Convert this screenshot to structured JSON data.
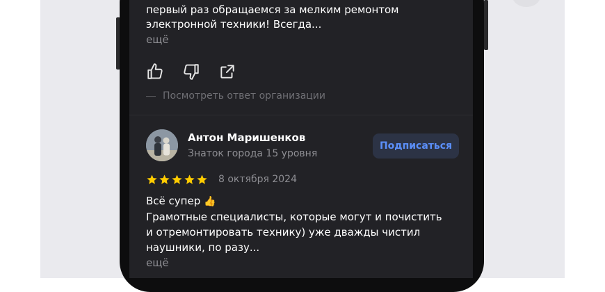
{
  "previous_review": {
    "text_line1": "первый раз обращаемся за мелким ремонтом",
    "text_line2": "электронной техники! Всегда...",
    "more_label": "ещё",
    "org_reply_label": "Посмотреть ответ организации",
    "actions": [
      "thumbs-up-icon",
      "thumbs-down-icon",
      "share-icon"
    ]
  },
  "review": {
    "author_name": "Антон Маришенков",
    "author_level": "Знаток города 15 уровня",
    "subscribe_label": "Подписаться",
    "rating": 5,
    "rating_max": 5,
    "date": "8 октября 2024",
    "title": "Всё супер",
    "title_emoji": "👍",
    "text_line1": "Грамотные специалисты, которые могут и почистить",
    "text_line2": "и отремонтировать технику) уже дважды чистил",
    "text_line3": "наушники, по разу...",
    "more_label": "ещё"
  },
  "colors": {
    "screen_bg": "#222226",
    "accent": "#5b8ff9",
    "star": "#ffcc00",
    "muted_text": "#8e8e93"
  }
}
